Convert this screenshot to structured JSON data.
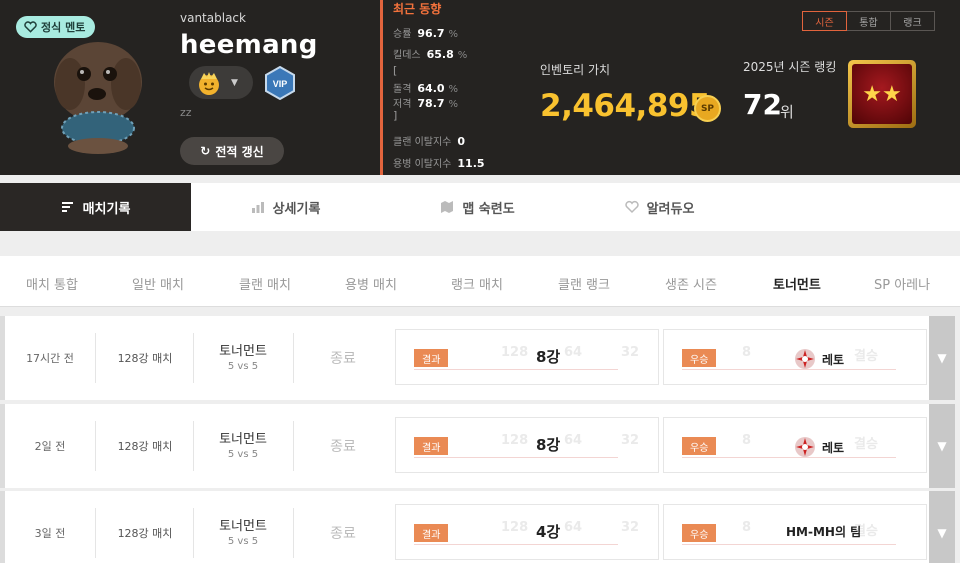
{
  "profile": {
    "mentor_badge": "정식 멘토",
    "clan": "vantablack",
    "nickname": "heemang",
    "vip": "VIP",
    "intro": "zz",
    "refresh_label": "전적 갱신"
  },
  "trend": {
    "title": "최근 동향",
    "win_rate_label": "승률",
    "win_rate": "96.7",
    "kd_label": "킬데스",
    "kd": "65.8",
    "assault_label": "돌격",
    "assault": "64.0",
    "sniper_label": "저격",
    "sniper": "78.7",
    "percent": "%",
    "bracket_open": "[",
    "bracket_close": "]",
    "clan_leave_label": "클랜 이탈지수",
    "clan_leave": "0",
    "merc_leave_label": "용병 이탈지수",
    "merc_leave": "11.5"
  },
  "inventory": {
    "label": "인벤토리 가치",
    "value": "2,464,895",
    "coin": "SP"
  },
  "season_rank": {
    "label": "2025년 시즌 랭킹",
    "value": "72",
    "unit": "위"
  },
  "toggle": {
    "items": [
      "시즌",
      "통합",
      "랭크"
    ],
    "active": "시즌"
  },
  "nav": {
    "items": [
      {
        "label": "매치기록",
        "icon": "list-icon"
      },
      {
        "label": "상세기록",
        "icon": "bar-chart-icon"
      },
      {
        "label": "맵 숙련도",
        "icon": "map-icon"
      },
      {
        "label": "알려듀오",
        "icon": "heart-icon"
      }
    ]
  },
  "subtabs": {
    "items": [
      "매치 통합",
      "일반 매치",
      "클랜 매치",
      "용병 매치",
      "랭크 매치",
      "클랜 랭크",
      "생존 시즌",
      "토너먼트",
      "SP 아레나"
    ],
    "active": "토너먼트"
  },
  "matches": [
    {
      "time": "17시간 전",
      "type": "128강 매치",
      "mode": "토너먼트",
      "format": "5 vs 5",
      "status": "종료",
      "result_tag": "결과",
      "result": "8강",
      "winner_tag": "우승",
      "winner": "레토",
      "winner_has_emblem": true,
      "bg_nums": [
        "128",
        "64",
        "32"
      ],
      "winner_bg": "8",
      "winner_bg2": "결승"
    },
    {
      "time": "2일 전",
      "type": "128강 매치",
      "mode": "토너먼트",
      "format": "5 vs 5",
      "status": "종료",
      "result_tag": "결과",
      "result": "8강",
      "winner_tag": "우승",
      "winner": "레토",
      "winner_has_emblem": true,
      "bg_nums": [
        "128",
        "64",
        "32"
      ],
      "winner_bg": "8",
      "winner_bg2": "결승"
    },
    {
      "time": "3일 전",
      "type": "128강 매치",
      "mode": "토너먼트",
      "format": "5 vs 5",
      "status": "종료",
      "result_tag": "결과",
      "result": "4강",
      "winner_tag": "우승",
      "winner": "HM-MH의 팀",
      "winner_has_emblem": false,
      "bg_nums": [
        "128",
        "64",
        "32"
      ],
      "winner_bg": "8",
      "winner_bg2": "결승"
    }
  ],
  "colors": {
    "accent": "#e2643d",
    "gold": "#f9c22f",
    "mentor": "#a8ebe0",
    "dark": "#252321"
  }
}
